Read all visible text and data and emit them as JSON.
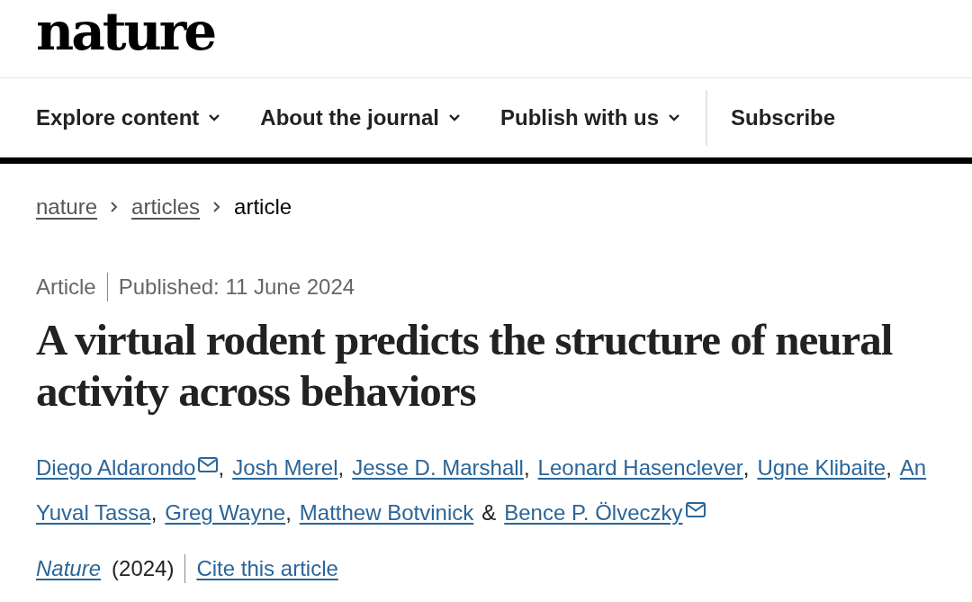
{
  "logo": "nature",
  "nav": [
    {
      "label": "Explore content",
      "kind": "menu"
    },
    {
      "label": "About the journal",
      "kind": "menu"
    },
    {
      "label": "Publish with us",
      "kind": "menu"
    },
    {
      "label": "Subscribe",
      "kind": "link"
    }
  ],
  "breadcrumbs": [
    {
      "label": "nature",
      "current": false
    },
    {
      "label": "articles",
      "current": false
    },
    {
      "label": "article",
      "current": true
    }
  ],
  "article_type": "Article",
  "published": "Published: 11 June 2024",
  "title": "A virtual rodent predicts the structure of neural activity across behaviors",
  "author_lines": [
    [
      {
        "name": "Diego Aldarondo",
        "email": true,
        "after": ","
      },
      {
        "name": "Josh Merel",
        "email": false,
        "after": ","
      },
      {
        "name": "Jesse D. Marshall",
        "email": false,
        "after": ","
      },
      {
        "name": "Leonard Hasenclever",
        "email": false,
        "after": ","
      },
      {
        "name": "Ugne Klibaite",
        "email": false,
        "after": ","
      },
      {
        "name": "An",
        "email": false
      }
    ],
    [
      {
        "name": "Yuval Tassa",
        "email": false,
        "after": ","
      },
      {
        "name": "Greg Wayne",
        "email": false,
        "after": ","
      },
      {
        "name": "Matthew Botvinick",
        "email": false,
        "before_next": "&"
      },
      {
        "name": "Bence P. Ölveczky",
        "email": true
      }
    ]
  ],
  "journal": "Nature",
  "year": "(2024)",
  "cite": "Cite this article"
}
